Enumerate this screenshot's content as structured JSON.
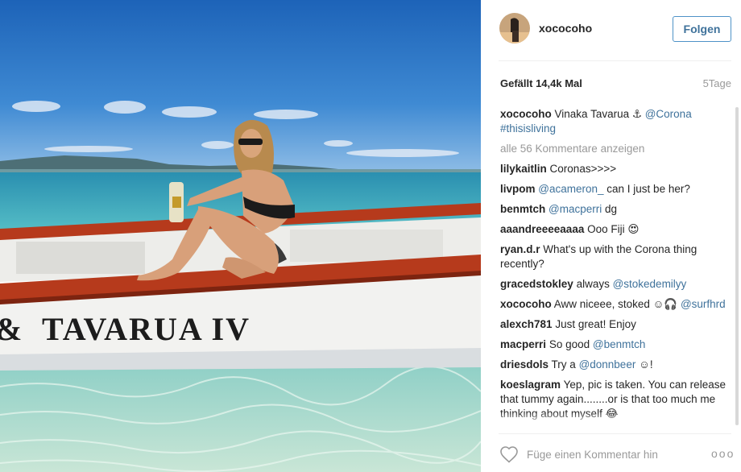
{
  "post": {
    "boat_text": "TAVARUA IV"
  },
  "header": {
    "username": "xococoho",
    "follow_label": "Folgen"
  },
  "stats": {
    "likes": "Gefällt 14,4k Mal",
    "age": "5Tage"
  },
  "caption": {
    "user": "xococoho",
    "text": "Vinaka Tavarua ⚓",
    "mention": "@Corona",
    "hashtag": "#thisisliving"
  },
  "view_all_label": "alle 56 Kommentare anzeigen",
  "comments": [
    {
      "user": "lilykaitlin",
      "pre": "Coronas>>>>",
      "mention": "",
      "post": ""
    },
    {
      "user": "livpom",
      "pre": "",
      "mention": "@acameron_",
      "post": " can I just be her?"
    },
    {
      "user": "benmtch",
      "pre": "",
      "mention": "@macperri",
      "post": " dg"
    },
    {
      "user": "aaandreeeeaaaa",
      "pre": "Ooo Fiji 😍",
      "mention": "",
      "post": ""
    },
    {
      "user": "ryan.d.r",
      "pre": "What's up with the Corona thing recently?",
      "mention": "",
      "post": ""
    },
    {
      "user": "gracedstokley",
      "pre": "always ",
      "mention": "@stokedemilyy",
      "post": ""
    },
    {
      "user": "xococoho",
      "pre": "Aww niceee, stoked ☺🎧 ",
      "mention": "@surfhrd",
      "post": ""
    },
    {
      "user": "alexch781",
      "pre": "Just great! Enjoy",
      "mention": "",
      "post": ""
    },
    {
      "user": "macperri",
      "pre": "So good ",
      "mention": "@benmtch",
      "post": ""
    },
    {
      "user": "driesdols",
      "pre": "Try a ",
      "mention": "@donnbeer",
      "post": " ☺!"
    },
    {
      "user": "koeslagram",
      "pre": "Yep, pic is taken. You can release that tummy again........or is that too much me thinking about myself 😂",
      "mention": "",
      "post": ""
    }
  ],
  "footer": {
    "comment_placeholder": "Füge einen Kommentar hin",
    "more_label": "ooo"
  },
  "colors": {
    "link": "#3f729b",
    "follow_border": "#4f93c7",
    "muted": "#999999",
    "text": "#262626"
  },
  "icons": [
    "heart-icon",
    "more-options-icon"
  ]
}
